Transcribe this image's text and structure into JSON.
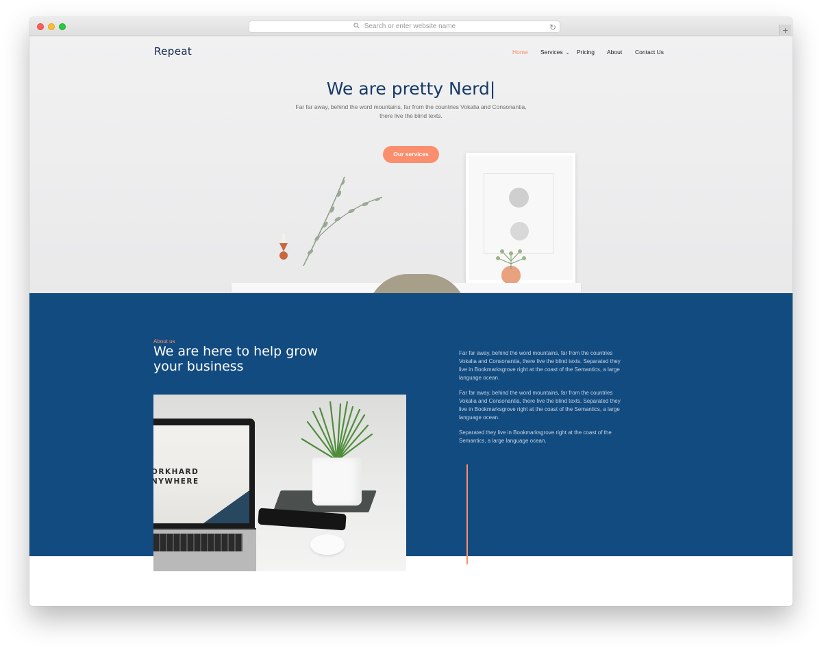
{
  "browser": {
    "address_placeholder": "Search or enter website name",
    "new_tab_label": "+"
  },
  "site": {
    "logo": "Repeat",
    "nav": [
      {
        "label": "Home",
        "active": true
      },
      {
        "label": "Services",
        "has_dropdown": true
      },
      {
        "label": "Pricing"
      },
      {
        "label": "About"
      },
      {
        "label": "Contact Us"
      }
    ]
  },
  "hero": {
    "title": "We are pretty Nerd|",
    "subtitle": "Far far away, behind the word mountains, far from the countries Vokalia and Consonantia, there live the blind texts.",
    "cta_label": "Our services"
  },
  "about": {
    "kicker": "About us",
    "title": "We are here to help grow your business",
    "paragraphs": [
      "Far far away, behind the word mountains, far from the countries Vokalia and Consonantia, there live the blind texts. Separated they live in Bookmarksgrove right at the coast of the Semantics, a large language ocean.",
      "Far far away, behind the word mountains, far from the countries Vokalia and Consonantia, there live the blind texts. Separated they live in Bookmarksgrove right at the coast of the Semantics, a large language ocean.",
      "Separated they live in Bookmarksgrove right at the coast of the Semantics, a large language ocean."
    ],
    "laptop_screen_lines": [
      "ORKHARD",
      "NYWHERE"
    ]
  },
  "colors": {
    "accent": "#fb8e6d",
    "navy": "#124b80",
    "heading": "#163a66"
  }
}
